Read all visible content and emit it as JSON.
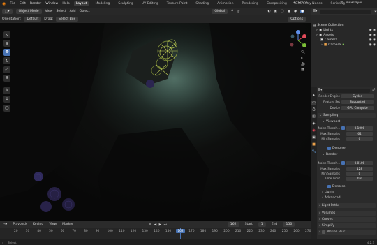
{
  "menus": [
    "File",
    "Edit",
    "Render",
    "Window",
    "Help"
  ],
  "workspaces": [
    "Layout",
    "Modeling",
    "Sculpting",
    "UV Editing",
    "Texture Paint",
    "Shading",
    "Animation",
    "Rendering",
    "Compositing",
    "Geometry Nodes",
    "Scripting"
  ],
  "active_workspace": "Layout",
  "scene_name": "Scene",
  "view_layer": "ViewLayer",
  "header": {
    "mode": "Object Mode",
    "view": "View",
    "select": "Select",
    "add": "Add",
    "object": "Object",
    "shading_mode": "Global",
    "orientation_label": "Orientation:",
    "orientation_value": "Default",
    "drag_label": "Drag:",
    "drag_value": "Select Box",
    "options": "Options"
  },
  "toolbar_icons": [
    "cursor-icon",
    "select-box-icon",
    "move-icon",
    "rotate-icon",
    "scale-icon",
    "transform-icon",
    "annotate-icon",
    "measure-icon",
    "add-cube-icon"
  ],
  "outliner": {
    "root": "Scene Collection",
    "items": [
      {
        "label": "Lights",
        "indent": 1
      },
      {
        "label": "Assets",
        "indent": 1
      },
      {
        "label": "Camera",
        "indent": 1
      },
      {
        "label": "Camera",
        "indent": 2
      }
    ]
  },
  "properties": {
    "search_placeholder": "",
    "render_engine_label": "Render Engine",
    "render_engine": "Cycles",
    "feature_set_label": "Feature Set",
    "feature_set": "Supported",
    "device_label": "Device",
    "device": "GPU Compute",
    "sampling": "Sampling",
    "viewport": "Viewport",
    "noise_threshold_label": "Noise Thresh...",
    "vp_noise_threshold": "0.1000",
    "max_samples_label": "Max Samples",
    "vp_max_samples": "64",
    "min_samples_label": "Min Samples",
    "vp_min_samples": "0",
    "denoise": "Denoise",
    "render": "Render",
    "r_noise_threshold": "0.0100",
    "r_max_samples": "128",
    "r_min_samples": "0",
    "time_limit_label": "Time Limit",
    "time_limit": "0 s",
    "lights": "Lights",
    "advanced": "Advanced",
    "light_paths": "Light Paths",
    "volumes": "Volumes",
    "curves": "Curves",
    "simplify": "Simplify",
    "motion_blur": "Motion Blur"
  },
  "timeline": {
    "playback": "Playback",
    "keying": "Keying",
    "view": "View",
    "marker": "Marker",
    "current_frame": "162",
    "start_label": "Start",
    "start": "1",
    "end_label": "End",
    "end": "150",
    "ruler": [
      "20",
      "30",
      "40",
      "50",
      "60",
      "70",
      "80",
      "90",
      "100",
      "110",
      "120",
      "130",
      "140",
      "150",
      "160",
      "170",
      "180",
      "190",
      "200",
      "210",
      "220",
      "230",
      "240",
      "250",
      "260",
      "270"
    ],
    "current_marker": "162"
  },
  "status": {
    "select": "Select",
    "version": "4.2.3"
  },
  "colors": {
    "accent": "#4772b3",
    "active_frame": "#4772b3",
    "panel": "#2b2b2b"
  }
}
